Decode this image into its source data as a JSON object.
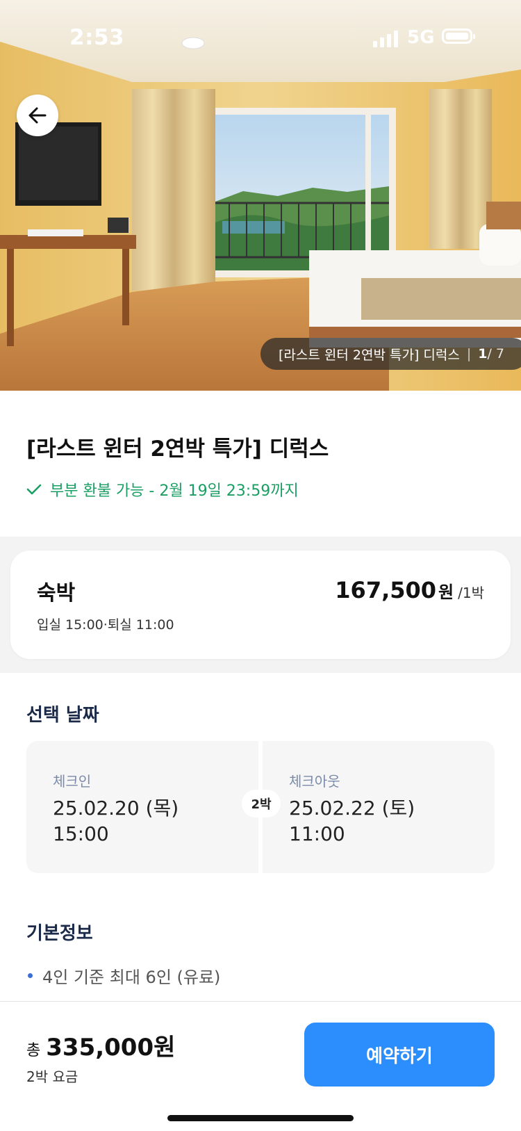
{
  "status_bar": {
    "time": "2:53",
    "network": "5G"
  },
  "hero": {
    "photo_title": "[라스트 윈터 2연박 특가] 디럭스",
    "photo_index": "1",
    "photo_total": "/ 7"
  },
  "room": {
    "title": "[라스트 윈터 2연박 특가] 디럭스",
    "refund_note": "부분 환불 가능 - 2월 19일 23:59까지"
  },
  "stay": {
    "label": "숙박",
    "times": "입실 15:00·퇴실 11:00",
    "price": "167,500",
    "currency": "원",
    "per": "/1박"
  },
  "dates": {
    "section_title": "선택 날짜",
    "checkin_label": "체크인",
    "checkin_date": "25.02.20 (목)",
    "checkin_time": "15:00",
    "nights": "2박",
    "checkout_label": "체크아웃",
    "checkout_date": "25.02.22 (토)",
    "checkout_time": "11:00"
  },
  "basic_info": {
    "section_title": "기본정보",
    "items": [
      "4인 기준 최대 6인 (유료)"
    ]
  },
  "bottom": {
    "total_prefix": "총",
    "total_amount": "335,000원",
    "total_sub": "2박 요금",
    "book_label": "예약하기"
  },
  "colors": {
    "accent_blue": "#2b8efc",
    "refund_green": "#1a9e63",
    "section_title": "#1c2a4a"
  },
  "icons": [
    "back-arrow-icon",
    "check-icon",
    "signal-icon",
    "battery-icon"
  ]
}
